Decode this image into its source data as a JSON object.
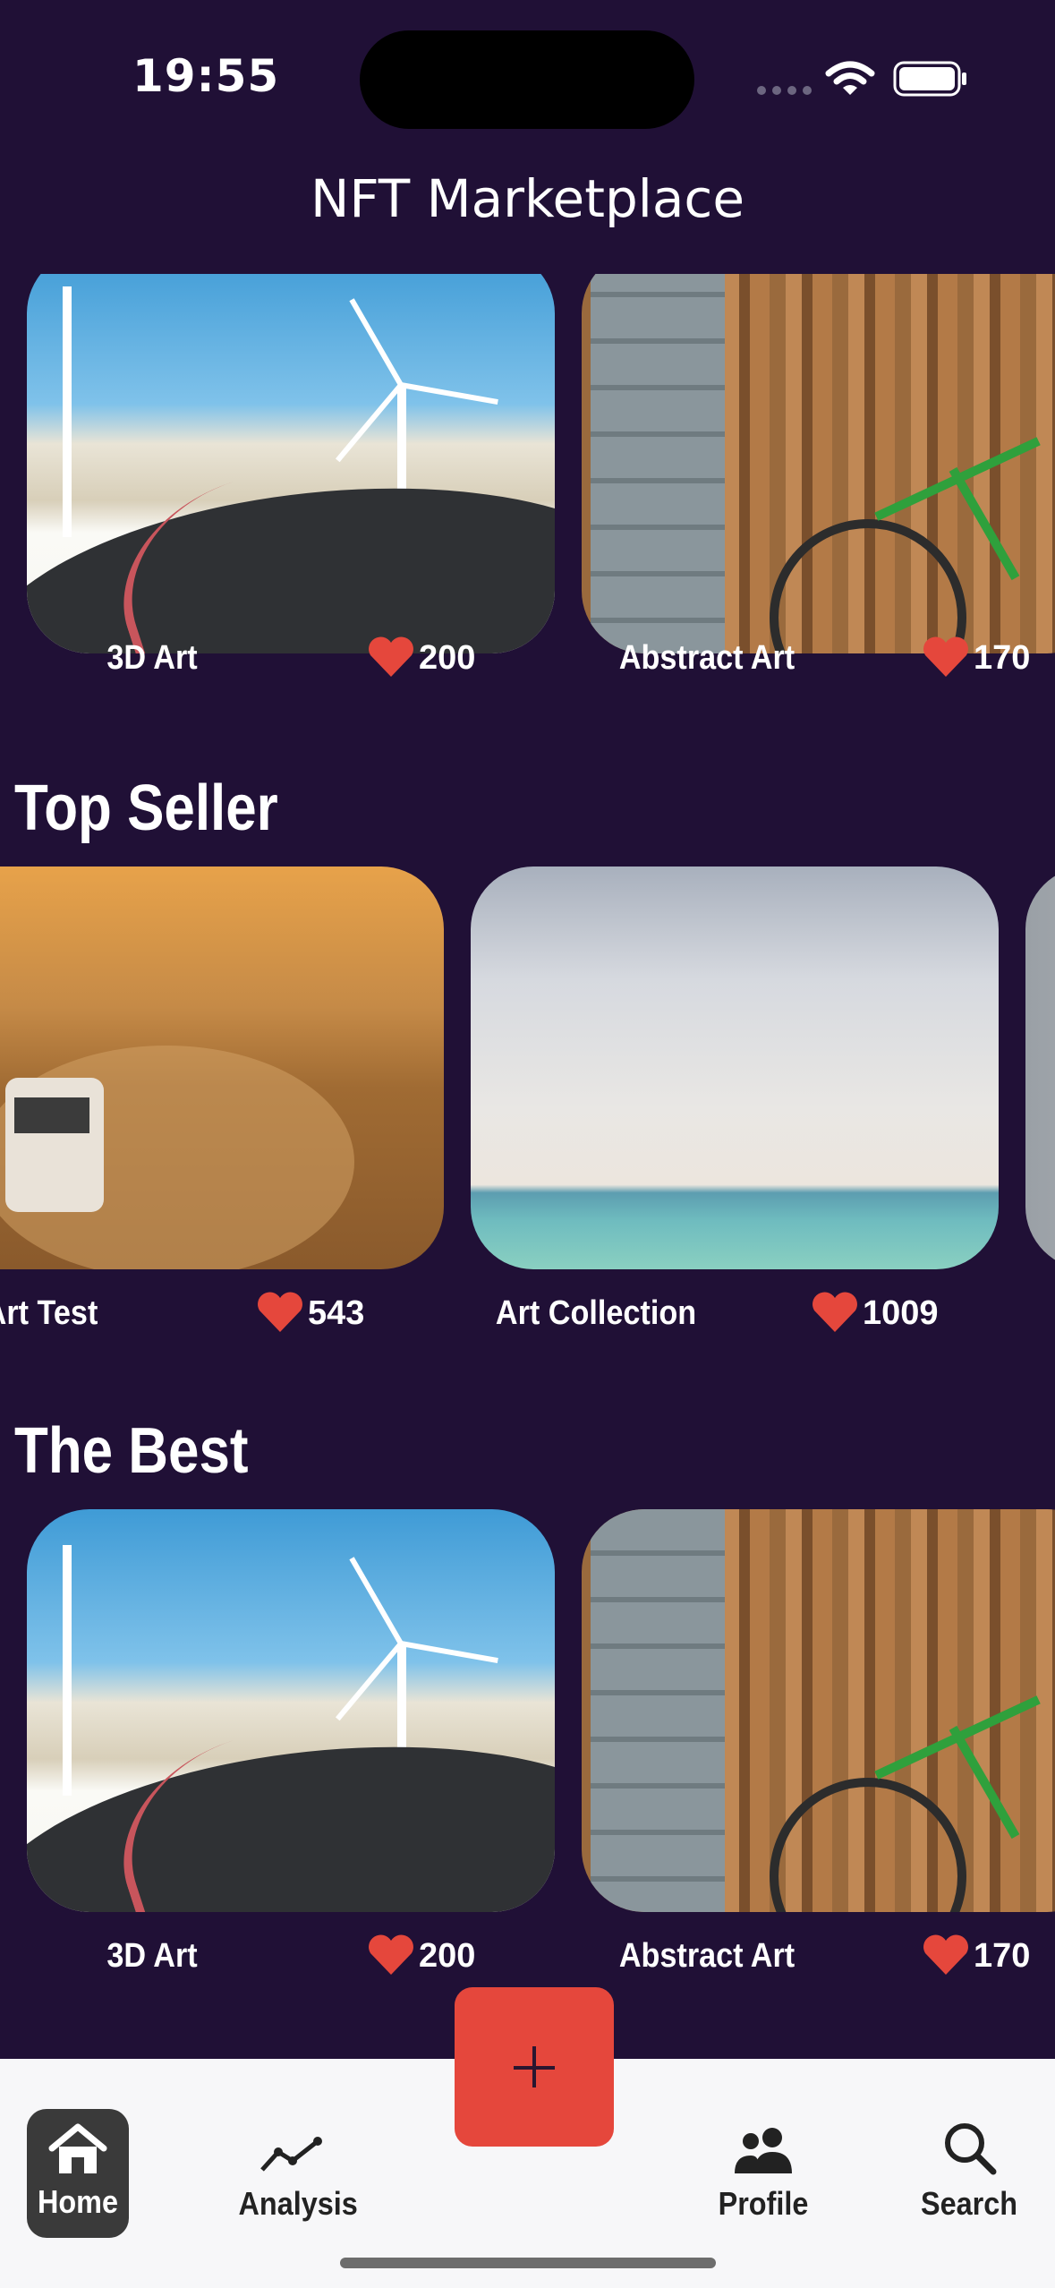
{
  "status_bar": {
    "time": "19:55"
  },
  "header": {
    "title": "NFT Marketplace"
  },
  "top_row": {
    "cards": [
      {
        "name": "3D Art",
        "likes": "200"
      },
      {
        "name": "Abstract Art",
        "likes": "170"
      }
    ]
  },
  "sections": [
    {
      "title": "Top Seller",
      "cards": [
        {
          "name": "Art Test",
          "likes": "543"
        },
        {
          "name": "Art Collection",
          "likes": "1009"
        }
      ]
    },
    {
      "title": "The Best",
      "cards": [
        {
          "name": "3D Art",
          "likes": "200"
        },
        {
          "name": "Abstract Art",
          "likes": "170"
        }
      ]
    }
  ],
  "tabbar": {
    "items": [
      {
        "label": "Home",
        "icon": "house-icon",
        "active": true
      },
      {
        "label": "Analysis",
        "icon": "line-chart-icon"
      },
      {
        "label": "Profile",
        "icon": "people-icon"
      },
      {
        "label": "Search",
        "icon": "magnifier-icon"
      }
    ],
    "fab_icon": "plus-icon"
  },
  "colors": {
    "background": "#201036",
    "accent": "#e5473c",
    "heart": "#e5473c",
    "tabbar": "#f7f7f9"
  }
}
